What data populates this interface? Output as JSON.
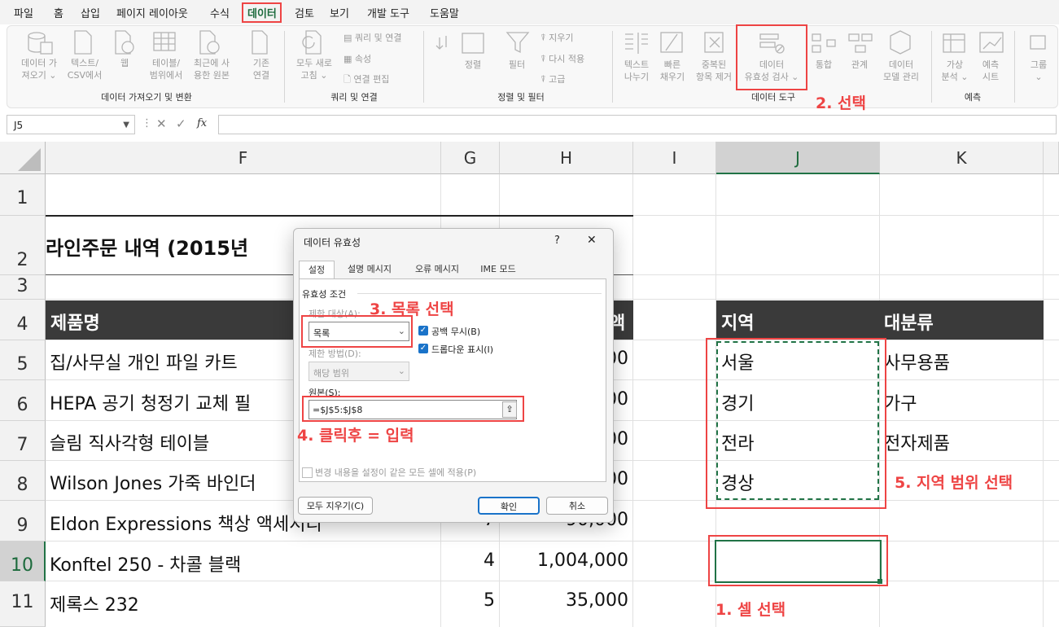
{
  "menu": [
    "파일",
    "홈",
    "삽입",
    "페이지 레이아웃",
    "수식",
    "데이터",
    "검토",
    "보기",
    "개발 도구",
    "도움말"
  ],
  "ribbon": {
    "get_data": [
      "데이터 가",
      "져오기 ⌄"
    ],
    "text_csv": [
      "텍스트/",
      "CSV에서"
    ],
    "web": "웹",
    "from_table": [
      "테이블/",
      "범위에서"
    ],
    "recent": [
      "최근에 사",
      "용한 원본"
    ],
    "existing": [
      "기존",
      "연결"
    ],
    "refresh_all": [
      "모두 새로",
      "고침 ⌄"
    ],
    "queries_connections": "쿼리 및 연결",
    "properties": "속성",
    "edit_links": "연결 편집",
    "sort": "정렬",
    "filter": "필터",
    "clear": "지우기",
    "reapply": "다시 적용",
    "advanced": "고급",
    "text_to_columns": [
      "텍스트",
      "나누기"
    ],
    "flash_fill": [
      "빠른",
      "채우기"
    ],
    "remove_dup": [
      "중복된",
      "항목 제거"
    ],
    "data_validation": [
      "데이터",
      "유효성 검사 ⌄"
    ],
    "consolidate": "통합",
    "relationships": "관계",
    "data_model": [
      "데이터",
      "모델 관리"
    ],
    "what_if": [
      "가상",
      "분석 ⌄"
    ],
    "forecast_sheet": [
      "예측",
      "시트"
    ],
    "group": [
      "그룹",
      "⌄"
    ],
    "groups": [
      "데이터 가져오기 및 변환",
      "쿼리 및 연결",
      "정렬 및 필터",
      "데이터 도구",
      "예측"
    ]
  },
  "formula_bar": {
    "name_box": "J5",
    "fx": "fx"
  },
  "columns": [
    "F",
    "G",
    "H",
    "I",
    "J",
    "K"
  ],
  "rows": [
    "1",
    "2",
    "3",
    "4",
    "5",
    "6",
    "7",
    "8",
    "9",
    "10",
    "11"
  ],
  "sheet": {
    "title": "라인주문 내역 (2015년",
    "header_product": "제품명",
    "header_amount_tail": "액",
    "header_region": "지역",
    "header_category": "대분류",
    "products": [
      "집/사무실 개인 파일 카트",
      "HEPA 공기 청정기 교체 필",
      "슬림 직사각형 테이블",
      "Wilson Jones 가죽 바인더",
      "Eldon Expressions 책상 액세서리",
      "Konftel 250 - 차콜 블랙",
      "제록스 232"
    ],
    "qty": [
      "7",
      "4",
      "5"
    ],
    "amounts_partial": [
      ",000",
      ",000",
      ",000",
      ",000"
    ],
    "amounts": [
      "90,000",
      "1,004,000",
      "35,000"
    ],
    "regions": [
      "서울",
      "경기",
      "전라",
      "경상"
    ],
    "categories": [
      "사무용품",
      "가구",
      "전자제품"
    ]
  },
  "dialog": {
    "title": "데이터 유효성",
    "help": "?",
    "close": "✕",
    "tabs": [
      "설정",
      "설명 메시지",
      "오류 메시지",
      "IME 모드"
    ],
    "criteria_label": "유효성 조건",
    "allow_label": "제한 대상(A):",
    "allow_value": "목록",
    "ignore_blank": "공백 무시(B)",
    "dropdown": "드롭다운 표시(I)",
    "data_label": "제한 방법(D):",
    "data_value": "해당 범위",
    "source_label": "원본(S):",
    "source_value": "=$J$5:$J$8",
    "apply_all": "변경 내용을 설정이 같은 모든 셀에 적용(P)",
    "clear_all": "모두 지우기(C)",
    "ok": "확인",
    "cancel": "취소"
  },
  "annotations": {
    "step1": "1. 셀 선택",
    "step2": "2. 선택",
    "step3": "3. 목록 선택",
    "step4": "4. 클릭후 = 입력",
    "step5": "5. 지역 범위 선택"
  },
  "colors": {
    "accent_red": "#ee4444",
    "excel_green": "#217346",
    "header_dark": "#3a3a3a"
  }
}
